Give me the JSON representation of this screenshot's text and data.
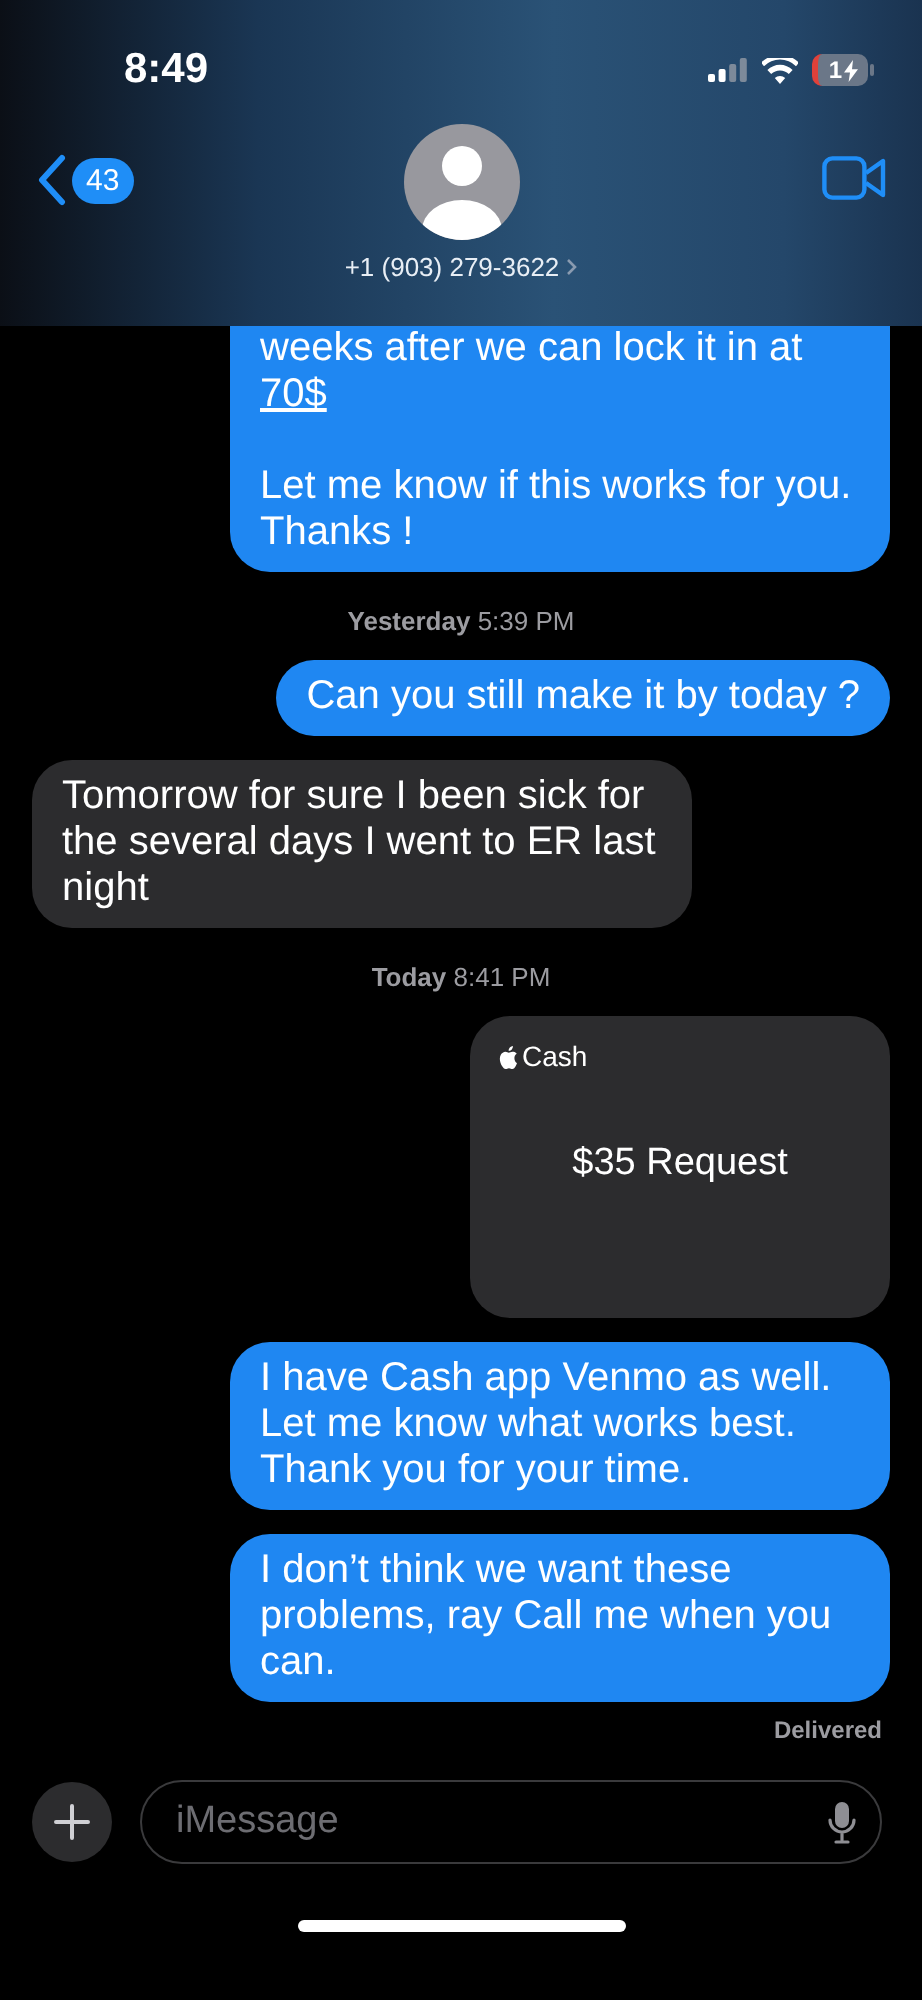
{
  "status_bar": {
    "time": "8:49",
    "battery": "1"
  },
  "header": {
    "back_count": "43",
    "contact": "+1 (903) 279-3622"
  },
  "messages": [
    {
      "kind": "bubble",
      "outgoing": true,
      "cut": true,
      "paragraphs": [
        {
          "text": "weeks after we can lock it in at ",
          "link": "70$"
        },
        {
          "text": "Let me know if this works for you. Thanks !"
        }
      ]
    },
    {
      "kind": "timestamp",
      "text": "**Yesterday** 5:39 PM"
    },
    {
      "kind": "bubble",
      "outgoing": true,
      "cut": false,
      "paragraphs": [
        {
          "text": "Can you still make it by today ?"
        }
      ]
    },
    {
      "kind": "bubble",
      "outgoing": false,
      "cut": false,
      "paragraphs": [
        {
          "text": "Tomorrow for sure I been sick for the several days I went to ER last night"
        }
      ]
    },
    {
      "kind": "timestamp",
      "text": "**Today** 8:41 PM"
    },
    {
      "kind": "cash",
      "outgoing": true,
      "brand": "Cash",
      "amount": "$35 Request"
    },
    {
      "kind": "bubble",
      "outgoing": true,
      "cut": false,
      "paragraphs": [
        {
          "text": "I have Cash app Venmo as well. Let me know what works best. Thank you for your time."
        }
      ]
    },
    {
      "kind": "bubble",
      "outgoing": true,
      "cut": false,
      "paragraphs": [
        {
          "text": "I don’t think we want these problems, ray Call me when you can."
        }
      ]
    }
  ],
  "delivery_status": "Delivered",
  "composer": {
    "placeholder": "iMessage"
  }
}
